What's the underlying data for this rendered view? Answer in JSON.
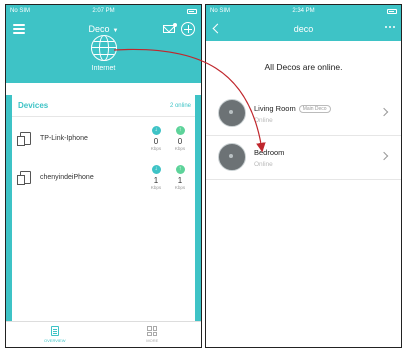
{
  "colors": {
    "accent": "#3ec3c6",
    "up_arrow": "#5dd39a",
    "annotation": "#c0272d"
  },
  "left": {
    "status": {
      "carrier": "No SIM",
      "time": "2:07 PM"
    },
    "nav": {
      "title": "Deco"
    },
    "internet_label": "Internet",
    "devices": {
      "title": "Devices",
      "count_text": "2 online",
      "items": [
        {
          "name": "TP-Link-Iphone",
          "down": "0",
          "up": "0",
          "unit": "Kbps"
        },
        {
          "name": "chenyindeiPhone",
          "down": "1",
          "up": "1",
          "unit": "Kbps"
        }
      ]
    },
    "tabs": {
      "overview": "OVERVIEW",
      "more": "MORE"
    }
  },
  "right": {
    "status": {
      "carrier": "No SIM",
      "time": "2:34 PM"
    },
    "nav": {
      "title": "deco"
    },
    "message": "All Decos are online.",
    "decos": [
      {
        "name": "Living Room",
        "badge": "Main Deco",
        "status": "Online"
      },
      {
        "name": "Bedroom",
        "badge": "",
        "status": "Online"
      }
    ]
  }
}
